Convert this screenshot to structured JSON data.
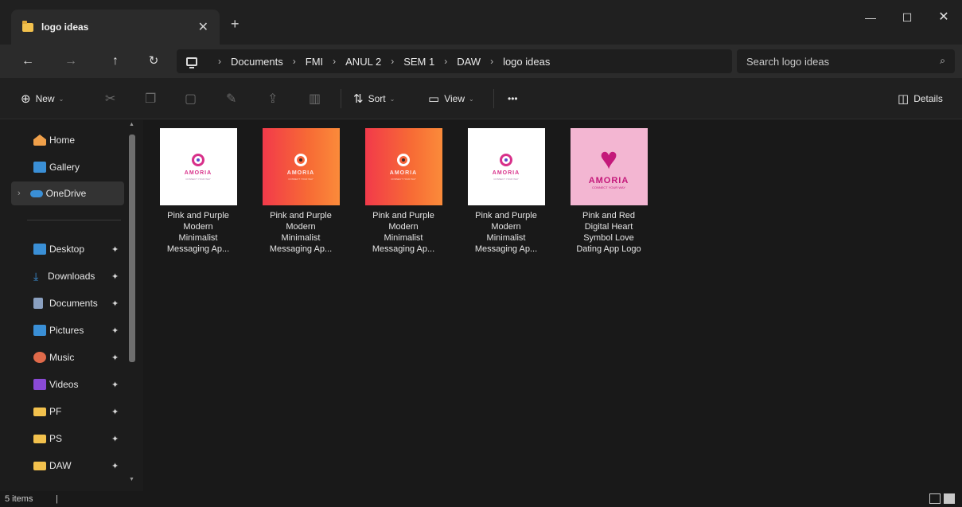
{
  "window": {
    "tab_title": "logo ideas",
    "tab_close": "✕",
    "new_tab": "+",
    "minimize": "—",
    "maximize": "☐",
    "close": "✕"
  },
  "nav": {
    "back": "←",
    "forward": "→",
    "up": "↑",
    "refresh": "↻",
    "breadcrumbs": [
      "Documents",
      "FMI",
      "ANUL 2",
      "SEM 1",
      "DAW",
      "logo ideas"
    ],
    "separator": "›",
    "search_placeholder": "Search logo ideas",
    "search_icon": "⌕"
  },
  "toolbar": {
    "new_label": "New",
    "sort_label": "Sort",
    "view_label": "View",
    "more_label": "•••",
    "details_label": "Details",
    "icons": {
      "new": "⊕",
      "cut": "✂",
      "copy": "❐",
      "paste": "📋",
      "rename": "✎",
      "share": "⇪",
      "delete": "🗑",
      "sort": "⇅",
      "view": "▭",
      "details": "◫"
    }
  },
  "sidebar": {
    "items": [
      {
        "label": "Home",
        "icon": "home-icon",
        "color": "#f0a04a"
      },
      {
        "label": "Gallery",
        "icon": "gallery-icon",
        "color": "#3a8fd6"
      },
      {
        "label": "OneDrive",
        "icon": "cloud-icon",
        "color": "#3a8fd6"
      },
      {
        "label": "Desktop",
        "icon": "desktop-icon",
        "color": "#3a8fd6"
      },
      {
        "label": "Downloads",
        "icon": "download-icon",
        "color": "#3a8fd6"
      },
      {
        "label": "Documents",
        "icon": "document-icon",
        "color": "#8aa0c0"
      },
      {
        "label": "Pictures",
        "icon": "pictures-icon",
        "color": "#3a8fd6"
      },
      {
        "label": "Music",
        "icon": "music-icon",
        "color": "#e06a4a"
      },
      {
        "label": "Videos",
        "icon": "videos-icon",
        "color": "#8a4ad6"
      },
      {
        "label": "PF",
        "icon": "folder-icon",
        "color": "#f2c14d"
      },
      {
        "label": "PS",
        "icon": "folder-icon",
        "color": "#f2c14d"
      },
      {
        "label": "DAW",
        "icon": "folder-icon",
        "color": "#f2c14d"
      }
    ],
    "pin": "📌",
    "expand": "›"
  },
  "files": [
    {
      "name": "Pink and Purple\nModern\nMinimalist\nMessaging Ap...",
      "style": "white",
      "logo": "AMORIA",
      "tagline": "CONNECT YOUR WAY"
    },
    {
      "name": "Pink and Purple\nModern\nMinimalist\nMessaging Ap...",
      "style": "orange",
      "logo": "AMORIA",
      "tagline": "CONNECT YOUR WAY"
    },
    {
      "name": "Pink and Purple\nModern\nMinimalist\nMessaging Ap...",
      "style": "orange",
      "logo": "AMORIA",
      "tagline": "CONNECT YOUR WAY"
    },
    {
      "name": "Pink and Purple\nModern\nMinimalist\nMessaging Ap...",
      "style": "white",
      "logo": "AMORIA",
      "tagline": "CONNECT YOUR WAY"
    },
    {
      "name": "Pink and Red\nDigital Heart\nSymbol Love\nDating App Logo",
      "style": "pink",
      "logo": "AMORIA",
      "tagline": "CONNECT YOUR WAY"
    }
  ],
  "status": {
    "count_text": "5 items",
    "caret": "|"
  },
  "colors": {
    "accent": "#3a8fd6",
    "folder": "#f2c14d",
    "background": "#191919"
  }
}
